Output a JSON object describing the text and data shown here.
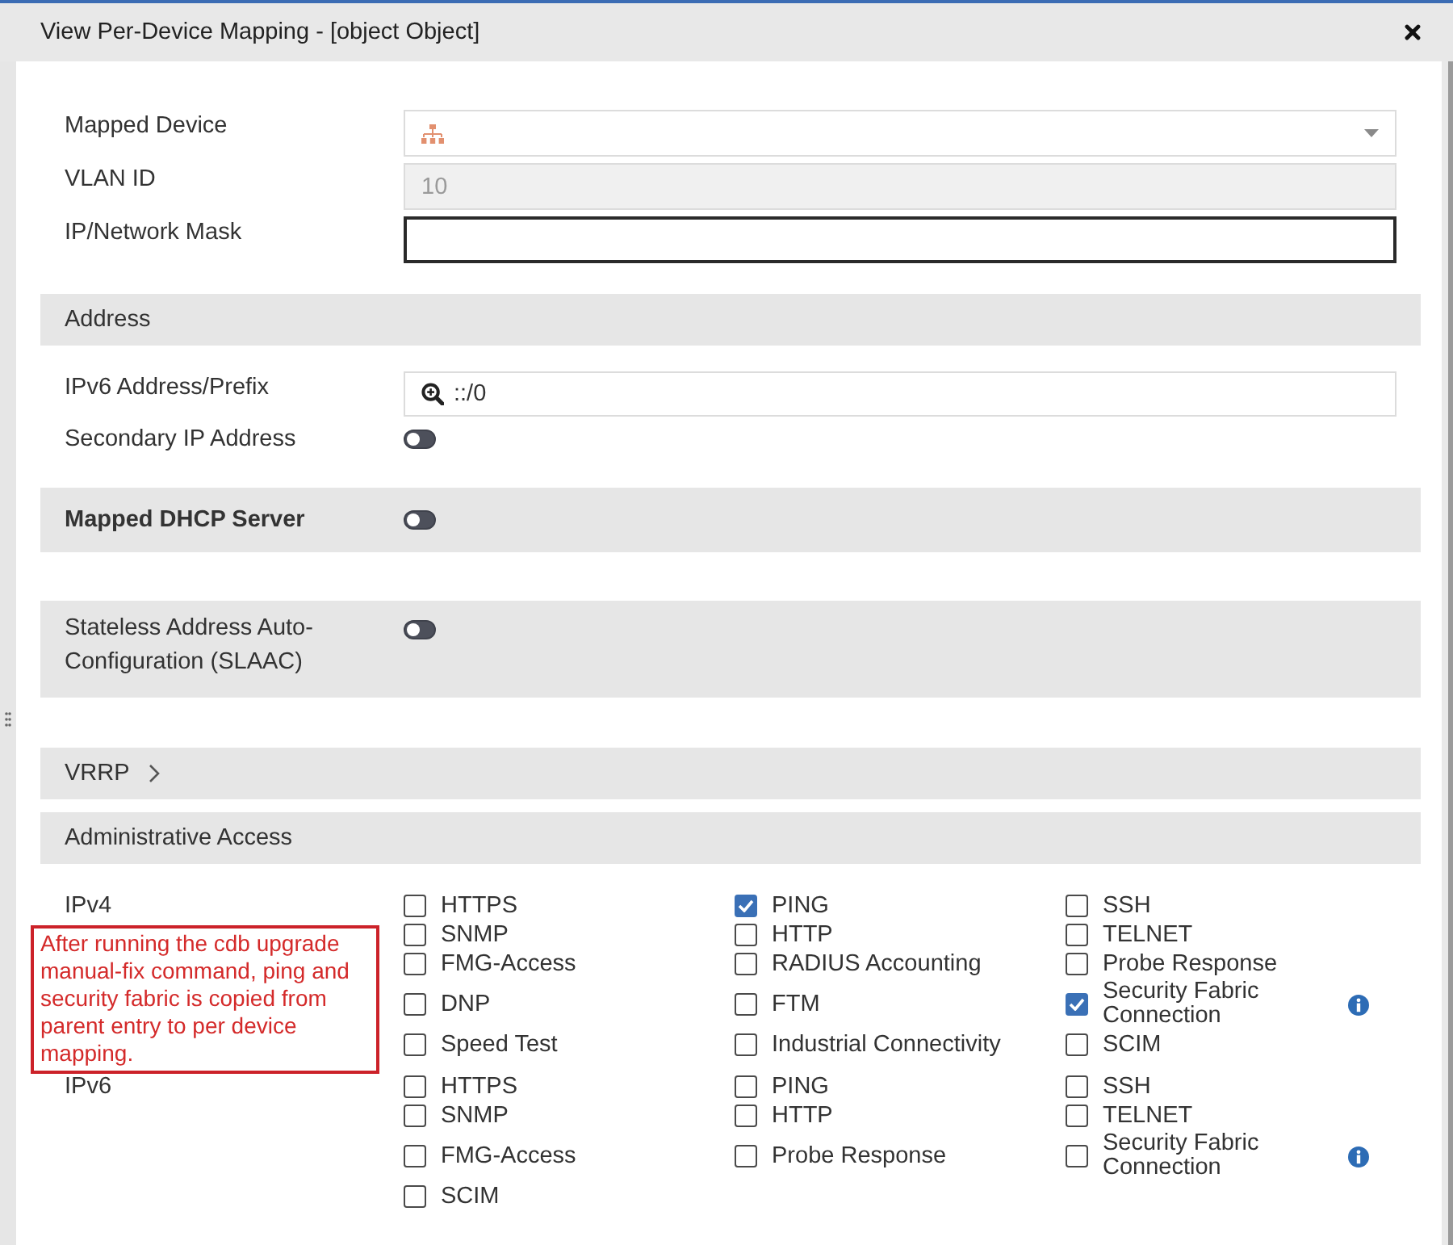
{
  "window": {
    "title": "View Per-Device Mapping - [object Object]"
  },
  "device_fields": [
    {
      "kind": "select",
      "label": "Mapped Device",
      "disabled": false,
      "focused": false
    },
    {
      "kind": "text",
      "label": "VLAN ID",
      "value": "10",
      "disabled": true,
      "focused": false
    },
    {
      "kind": "text",
      "label": "IP/Network Mask",
      "disabled": false,
      "focused": true
    }
  ],
  "address": {
    "title": "Address",
    "ipv6_prefix": {
      "label": "IPv6 Address/Prefix",
      "value": "::/0"
    },
    "secondary_ip": {
      "label": "Secondary IP Address",
      "on": false
    }
  },
  "mapped_dhcp_server": {
    "label": "Mapped DHCP Server",
    "on": false
  },
  "slaac": {
    "label": "Stateless Address Auto-Configuration (SLAAC)",
    "on": false
  },
  "vrrp": {
    "label": "VRRP",
    "expanded": false
  },
  "administrative_access": {
    "title": "Administrative Access",
    "groups": [
      {
        "label": "IPv4",
        "rows": [
          {
            "info": false,
            "options": [
              {
                "label": "HTTPS",
                "checked": false
              },
              {
                "label": "PING",
                "checked": true
              },
              {
                "label": "SSH",
                "checked": false
              }
            ]
          },
          {
            "info": false,
            "options": [
              {
                "label": "SNMP",
                "checked": false
              },
              {
                "label": "HTTP",
                "checked": false
              },
              {
                "label": "TELNET",
                "checked": false
              }
            ]
          },
          {
            "info": false,
            "options": [
              {
                "label": "FMG-Access",
                "checked": false
              },
              {
                "label": "RADIUS Accounting",
                "checked": false
              },
              {
                "label": "Probe Response",
                "checked": false
              }
            ]
          },
          {
            "info": true,
            "options": [
              {
                "label": "DNP",
                "checked": false
              },
              {
                "label": "FTM",
                "checked": false
              },
              {
                "label": "Security Fabric Connection",
                "checked": true
              }
            ]
          },
          {
            "info": false,
            "options": [
              {
                "label": "Speed Test",
                "checked": false
              },
              {
                "label": "Industrial Connectivity",
                "checked": false
              },
              {
                "label": "SCIM",
                "checked": false
              }
            ]
          }
        ]
      },
      {
        "label": "IPv6",
        "rows": [
          {
            "info": false,
            "options": [
              {
                "label": "HTTPS",
                "checked": false
              },
              {
                "label": "PING",
                "checked": false
              },
              {
                "label": "SSH",
                "checked": false
              }
            ]
          },
          {
            "info": false,
            "options": [
              {
                "label": "SNMP",
                "checked": false
              },
              {
                "label": "HTTP",
                "checked": false
              },
              {
                "label": "TELNET",
                "checked": false
              }
            ]
          },
          {
            "info": true,
            "options": [
              {
                "label": "FMG-Access",
                "checked": false
              },
              {
                "label": "Probe Response",
                "checked": false
              },
              {
                "label": "Security Fabric Connection",
                "checked": false
              }
            ]
          },
          {
            "info": false,
            "options": [
              {
                "label": "SCIM",
                "checked": false
              }
            ]
          }
        ]
      }
    ]
  },
  "annotation": {
    "text": "After running the cdb upgrade manual-fix command, ping and security fabric is copied from parent entry to per device mapping."
  }
}
